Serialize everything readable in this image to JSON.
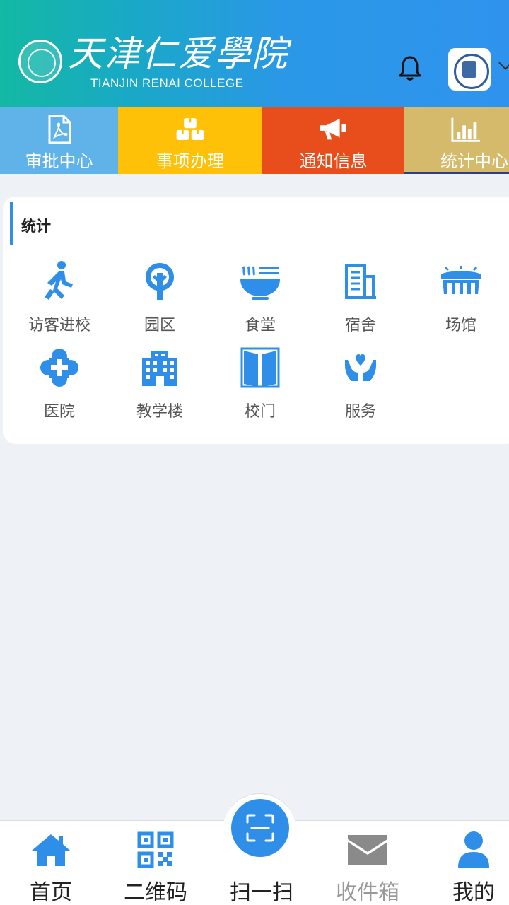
{
  "header": {
    "logo_cn": "天津仁爱學院",
    "logo_en": "TIANJIN RENAI COLLEGE",
    "icons": {
      "emblem": "college-emblem-icon",
      "bell": "bell-icon",
      "avatar": "user-avatar",
      "caret": "chevron-down-icon"
    }
  },
  "tabs": [
    {
      "label": "审批中心",
      "icon": "pdf-document-icon",
      "color": "#5fb3e8"
    },
    {
      "label": "事项办理",
      "icon": "boxes-icon",
      "color": "#ffc107"
    },
    {
      "label": "通知信息",
      "icon": "megaphone-icon",
      "color": "#e84e1b"
    },
    {
      "label": "统计中心",
      "icon": "bar-chart-icon",
      "color": "#d5ba6b"
    }
  ],
  "section": {
    "title": "统计",
    "items": [
      {
        "label": "访客进校",
        "icon": "walking-person-icon"
      },
      {
        "label": "园区",
        "icon": "tree-icon"
      },
      {
        "label": "食堂",
        "icon": "noodle-bowl-icon"
      },
      {
        "label": "宿舍",
        "icon": "building-icon"
      },
      {
        "label": "场馆",
        "icon": "stadium-icon"
      },
      {
        "label": "医院",
        "icon": "medical-cross-icon"
      },
      {
        "label": "教学楼",
        "icon": "school-building-icon"
      },
      {
        "label": "校门",
        "icon": "gate-icon"
      },
      {
        "label": "服务",
        "icon": "heart-hands-icon"
      }
    ]
  },
  "tabbar": {
    "items": [
      {
        "label": "首页",
        "icon": "home-icon"
      },
      {
        "label": "二维码",
        "icon": "qr-code-icon"
      },
      {
        "label": "扫一扫",
        "icon": "scan-icon"
      },
      {
        "label": "收件箱",
        "icon": "envelope-icon"
      },
      {
        "label": "我的",
        "icon": "person-icon"
      }
    ]
  },
  "colors": {
    "accent": "#2f8fe8",
    "background": "#eef1f6"
  }
}
